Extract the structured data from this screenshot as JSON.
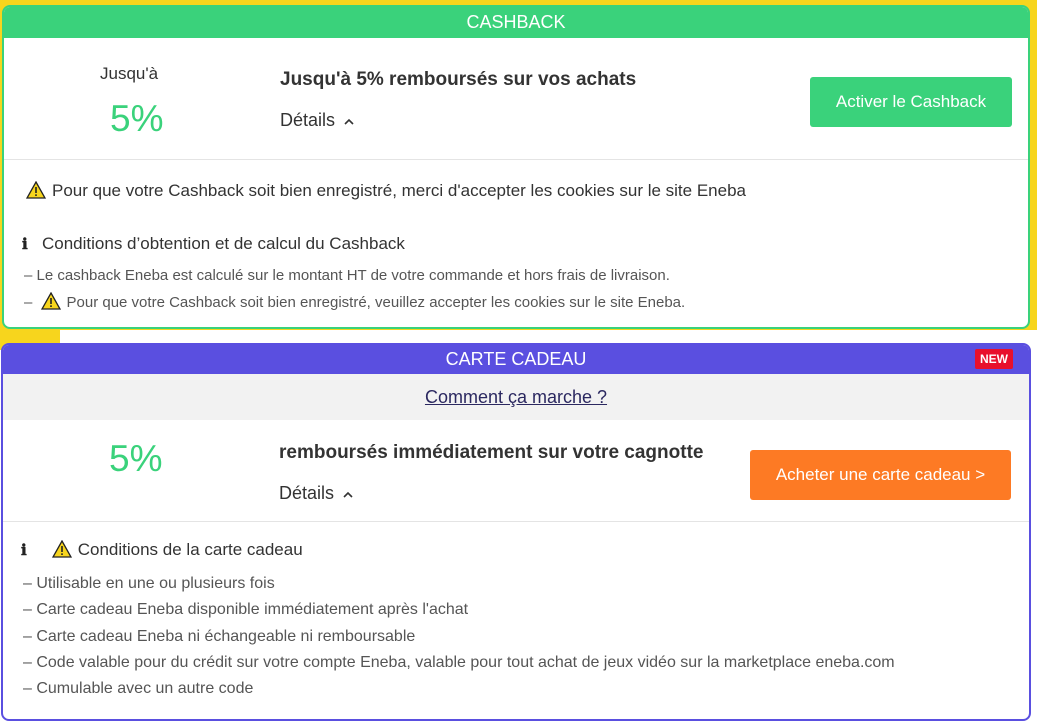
{
  "cashback": {
    "header": "CASHBACK",
    "upto_label": "Jusqu'à",
    "percent": "5%",
    "headline": "Jusqu'à 5% remboursés sur vos achats",
    "details_label": "Détails",
    "button_label": "Activer le Cashback",
    "warning": "Pour que votre Cashback soit bien enregistré, merci d'accepter les cookies sur le site Eneba",
    "conditions_title": "Conditions d’obtention et de calcul du Cashback",
    "condition_line_1": "– Le cashback Eneba est calculé sur le montant HT de votre commande et hors frais de livraison.",
    "condition_line_2_prefix": "–",
    "condition_line_2": "Pour que votre Cashback soit bien enregistré, veuillez accepter les cookies sur le site Eneba."
  },
  "gift_card": {
    "header": "CARTE CADEAU",
    "badge": "NEW",
    "how_link": "Comment ça marche ?",
    "percent": "5%",
    "headline": "remboursés immédiatement sur votre cagnotte",
    "details_label": "Détails",
    "button_label": "Acheter une carte cadeau >",
    "conditions_title": "Conditions de la carte cadeau",
    "conditions": [
      "– Utilisable en une ou plusieurs fois",
      "– Carte cadeau Eneba disponible immédiatement après l'achat",
      "– Carte cadeau Eneba ni échangeable ni remboursable",
      "– Code valable pour du crédit sur votre compte Eneba, valable pour tout achat de jeux vidéo sur la marketplace eneba.com",
      "– Cumulable avec un autre code"
    ]
  },
  "colors": {
    "green": "#3ad27b",
    "purple": "#5a4fe0",
    "orange": "#fd7a24",
    "yellow": "#f7d51d",
    "badge_red": "#e8102c"
  },
  "icons": [
    "warning-icon",
    "info-icon",
    "chevron-up-icon"
  ]
}
